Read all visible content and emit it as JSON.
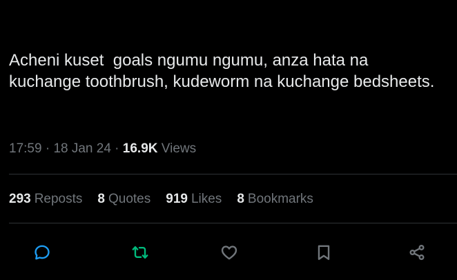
{
  "tweet": {
    "text": "Acheni kuset  goals ngumu ngumu, anza hata na kuchange toothbrush, kudeworm na kuchange bedsheets.",
    "time": "17:59",
    "separator": " · ",
    "date": "18 Jan 24",
    "views_count": "16.9K",
    "views_label": "Views"
  },
  "stats": [
    {
      "count": "293",
      "label": "Reposts"
    },
    {
      "count": "8",
      "label": "Quotes"
    },
    {
      "count": "919",
      "label": "Likes"
    },
    {
      "count": "8",
      "label": "Bookmarks"
    }
  ],
  "actions": {
    "reply_icon": "reply-icon",
    "repost_icon": "repost-icon",
    "like_icon": "like-icon",
    "bookmark_icon": "bookmark-icon",
    "share_icon": "share-icon"
  },
  "colors": {
    "background": "#000000",
    "primary_text": "#e7e9ea",
    "secondary_text": "#71767b",
    "divider": "#2f3336",
    "reply_icon": "#1d9bf0",
    "repost_icon": "#00ba7c",
    "default_icon": "#71767b"
  }
}
